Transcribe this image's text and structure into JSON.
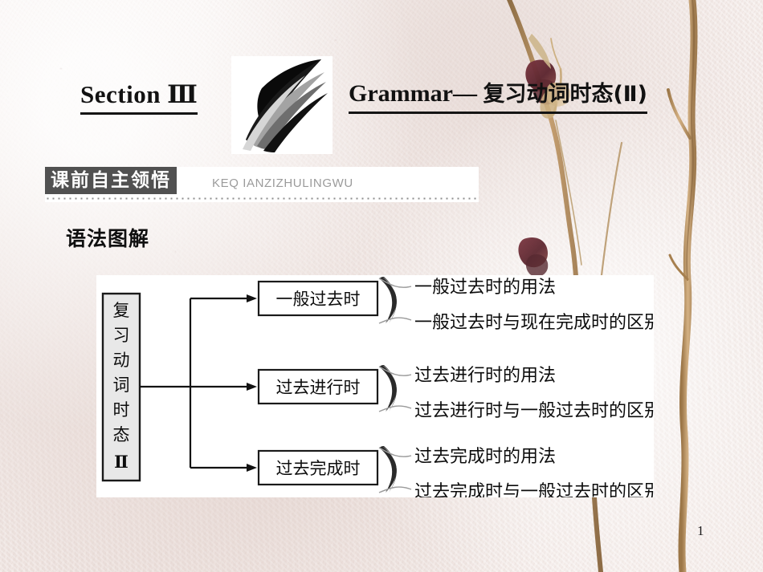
{
  "header": {
    "section_label": "Section Ⅲ",
    "title_en": "Grammar— ",
    "title_cn": "复习动词时态(Ⅱ)",
    "logo_icon": "brush-stroke-swoosh-logo"
  },
  "banner": {
    "tag": "课前自主领悟",
    "pinyin": "KEQ IANZIZHULINGWU"
  },
  "sub_heading": "语法图解",
  "diagram": {
    "root_label": "复习动词时态Ⅱ",
    "root_chars": [
      "复",
      "习",
      "动",
      "词",
      "时",
      "态",
      "Ⅱ"
    ],
    "branches": [
      {
        "node": "一般过去时",
        "leaves": [
          "一般过去时的用法",
          "一般过去时与现在完成时的区别"
        ]
      },
      {
        "node": "过去进行时",
        "leaves": [
          "过去进行时的用法",
          "过去进行时与一般过去时的区别"
        ]
      },
      {
        "node": "过去完成时",
        "leaves": [
          "过去完成时的用法",
          "过去完成时与一般过去时的区别"
        ]
      }
    ]
  },
  "page_number": "1",
  "colors": {
    "background": "#f3ebe8",
    "panel": "#ffffff",
    "banner_tag_bg": "#515151",
    "node_fill": "#e8e8e8",
    "ink": "#0d0d0d",
    "branch_brown": "#b08756",
    "bud_maroon": "#6e3038"
  }
}
